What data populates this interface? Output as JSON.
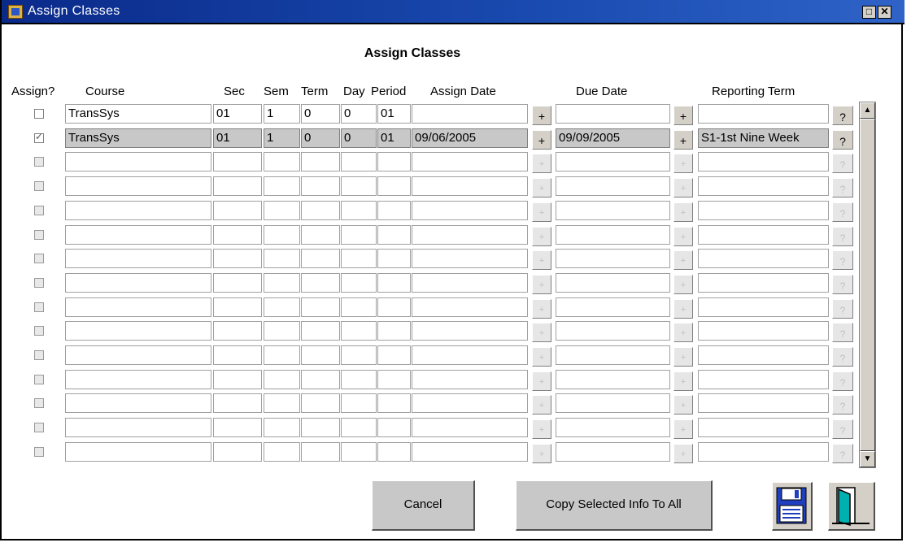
{
  "window": {
    "title": "Assign Classes",
    "restore_glyph": "□",
    "close_glyph": "✕"
  },
  "heading": "Assign Classes",
  "columns": {
    "assign": "Assign?",
    "course": "Course",
    "sec": "Sec",
    "sem": "Sem",
    "term": "Term",
    "day": "Day",
    "period": "Period",
    "assign_date": "Assign Date",
    "due_date": "Due Date",
    "reporting_term": "Reporting Term"
  },
  "rows": [
    {
      "checked": false,
      "enabled": true,
      "selected": false,
      "course": "TransSys",
      "sec": "01",
      "sem": "1",
      "term": "0",
      "day": "0",
      "period": "01",
      "assign_date": "",
      "due_date": "",
      "reporting_term": ""
    },
    {
      "checked": true,
      "enabled": true,
      "selected": true,
      "course": "TransSys",
      "sec": "01",
      "sem": "1",
      "term": "0",
      "day": "0",
      "period": "01",
      "assign_date": "09/06/2005",
      "due_date": "09/09/2005",
      "reporting_term": "S1-1st Nine Week"
    },
    {
      "checked": false,
      "enabled": false,
      "selected": false,
      "course": "",
      "sec": "",
      "sem": "",
      "term": "",
      "day": "",
      "period": "",
      "assign_date": "",
      "due_date": "",
      "reporting_term": ""
    },
    {
      "checked": false,
      "enabled": false,
      "selected": false,
      "course": "",
      "sec": "",
      "sem": "",
      "term": "",
      "day": "",
      "period": "",
      "assign_date": "",
      "due_date": "",
      "reporting_term": ""
    },
    {
      "checked": false,
      "enabled": false,
      "selected": false,
      "course": "",
      "sec": "",
      "sem": "",
      "term": "",
      "day": "",
      "period": "",
      "assign_date": "",
      "due_date": "",
      "reporting_term": ""
    },
    {
      "checked": false,
      "enabled": false,
      "selected": false,
      "course": "",
      "sec": "",
      "sem": "",
      "term": "",
      "day": "",
      "period": "",
      "assign_date": "",
      "due_date": "",
      "reporting_term": ""
    },
    {
      "checked": false,
      "enabled": false,
      "selected": false,
      "course": "",
      "sec": "",
      "sem": "",
      "term": "",
      "day": "",
      "period": "",
      "assign_date": "",
      "due_date": "",
      "reporting_term": ""
    },
    {
      "checked": false,
      "enabled": false,
      "selected": false,
      "course": "",
      "sec": "",
      "sem": "",
      "term": "",
      "day": "",
      "period": "",
      "assign_date": "",
      "due_date": "",
      "reporting_term": ""
    },
    {
      "checked": false,
      "enabled": false,
      "selected": false,
      "course": "",
      "sec": "",
      "sem": "",
      "term": "",
      "day": "",
      "period": "",
      "assign_date": "",
      "due_date": "",
      "reporting_term": ""
    },
    {
      "checked": false,
      "enabled": false,
      "selected": false,
      "course": "",
      "sec": "",
      "sem": "",
      "term": "",
      "day": "",
      "period": "",
      "assign_date": "",
      "due_date": "",
      "reporting_term": ""
    },
    {
      "checked": false,
      "enabled": false,
      "selected": false,
      "course": "",
      "sec": "",
      "sem": "",
      "term": "",
      "day": "",
      "period": "",
      "assign_date": "",
      "due_date": "",
      "reporting_term": ""
    },
    {
      "checked": false,
      "enabled": false,
      "selected": false,
      "course": "",
      "sec": "",
      "sem": "",
      "term": "",
      "day": "",
      "period": "",
      "assign_date": "",
      "due_date": "",
      "reporting_term": ""
    },
    {
      "checked": false,
      "enabled": false,
      "selected": false,
      "course": "",
      "sec": "",
      "sem": "",
      "term": "",
      "day": "",
      "period": "",
      "assign_date": "",
      "due_date": "",
      "reporting_term": ""
    },
    {
      "checked": false,
      "enabled": false,
      "selected": false,
      "course": "",
      "sec": "",
      "sem": "",
      "term": "",
      "day": "",
      "period": "",
      "assign_date": "",
      "due_date": "",
      "reporting_term": ""
    },
    {
      "checked": false,
      "enabled": false,
      "selected": false,
      "course": "",
      "sec": "",
      "sem": "",
      "term": "",
      "day": "",
      "period": "",
      "assign_date": "",
      "due_date": "",
      "reporting_term": ""
    }
  ],
  "glyphs": {
    "plus": "+",
    "lookup": "?",
    "scroll_up": "▲",
    "scroll_down": "▼"
  },
  "buttons": {
    "cancel": "Cancel",
    "copy_all": "Copy Selected Info To All"
  },
  "icons": {
    "app": "app-icon",
    "save": "save-disk-icon",
    "exit": "exit-door-icon"
  }
}
